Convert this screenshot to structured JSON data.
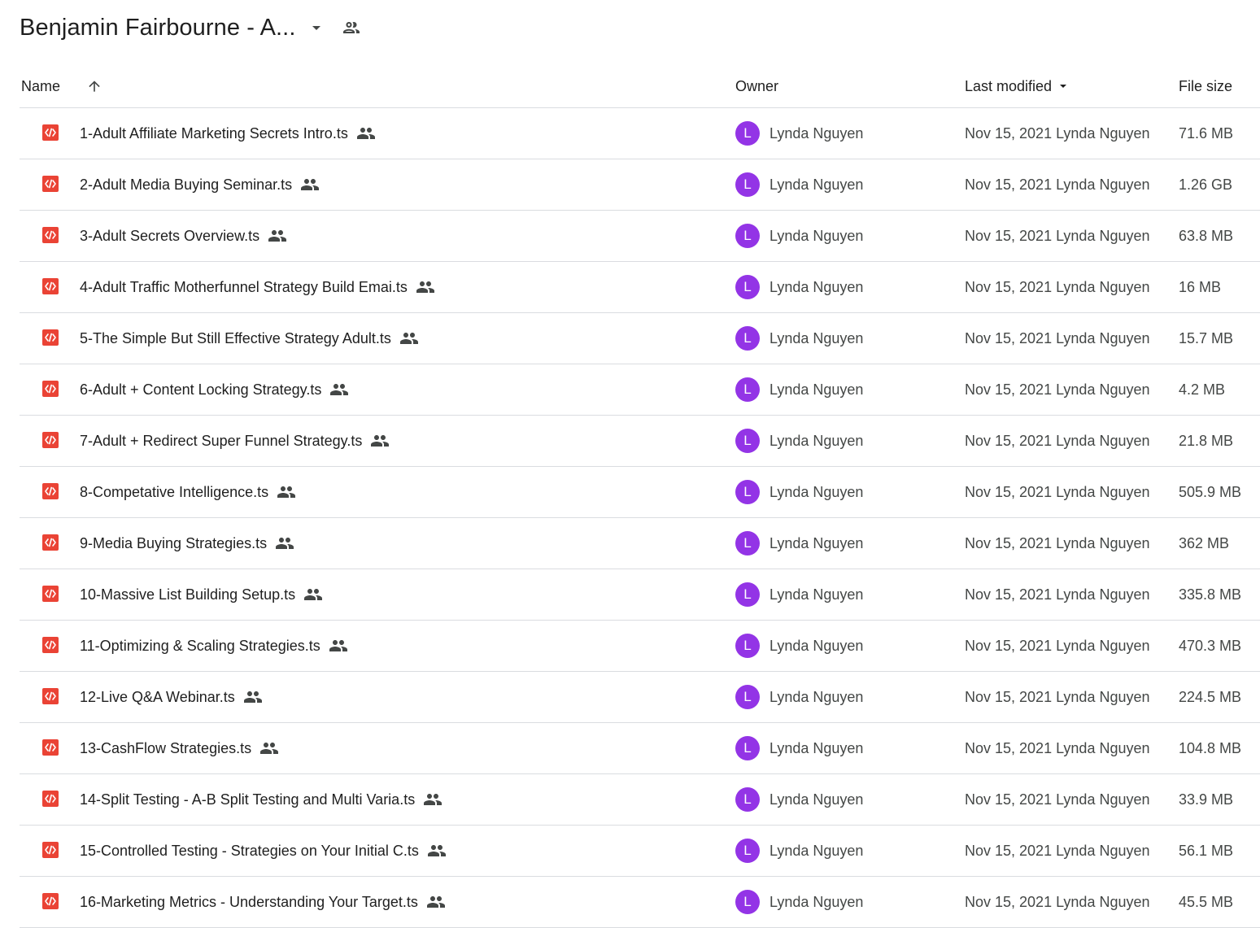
{
  "header": {
    "folder_title": "Benjamin Fairbourne - A...",
    "dropdown_icon": "arrow-drop-down-icon",
    "share_icon": "people-outline-icon"
  },
  "columns": {
    "name": "Name",
    "owner": "Owner",
    "last_modified": "Last modified",
    "file_size": "File size"
  },
  "sort": {
    "column": "Last modified",
    "icon": "arrow-up-icon"
  },
  "colors": {
    "file_icon": "#ea4335",
    "avatar": "#9334e6",
    "divider": "#dadce0"
  },
  "files": [
    {
      "name": "1-Adult Affiliate Marketing Secrets Intro.ts",
      "owner": "Lynda Nguyen",
      "owner_initial": "L",
      "modified": "Nov 15, 2021 Lynda Nguyen",
      "size": "71.6 MB"
    },
    {
      "name": "2-Adult Media Buying Seminar.ts",
      "owner": "Lynda Nguyen",
      "owner_initial": "L",
      "modified": "Nov 15, 2021 Lynda Nguyen",
      "size": "1.26 GB"
    },
    {
      "name": "3-Adult Secrets Overview.ts",
      "owner": "Lynda Nguyen",
      "owner_initial": "L",
      "modified": "Nov 15, 2021 Lynda Nguyen",
      "size": "63.8 MB"
    },
    {
      "name": "4-Adult Traffic Motherfunnel Strategy Build Emai.ts",
      "owner": "Lynda Nguyen",
      "owner_initial": "L",
      "modified": "Nov 15, 2021 Lynda Nguyen",
      "size": "16 MB"
    },
    {
      "name": "5-The Simple But Still Effective Strategy Adult.ts",
      "owner": "Lynda Nguyen",
      "owner_initial": "L",
      "modified": "Nov 15, 2021 Lynda Nguyen",
      "size": "15.7 MB"
    },
    {
      "name": "6-Adult + Content Locking Strategy.ts",
      "owner": "Lynda Nguyen",
      "owner_initial": "L",
      "modified": "Nov 15, 2021 Lynda Nguyen",
      "size": "4.2 MB"
    },
    {
      "name": "7-Adult + Redirect Super Funnel Strategy.ts",
      "owner": "Lynda Nguyen",
      "owner_initial": "L",
      "modified": "Nov 15, 2021 Lynda Nguyen",
      "size": "21.8 MB"
    },
    {
      "name": "8-Competative Intelligence.ts",
      "owner": "Lynda Nguyen",
      "owner_initial": "L",
      "modified": "Nov 15, 2021 Lynda Nguyen",
      "size": "505.9 MB"
    },
    {
      "name": "9-Media Buying Strategies.ts",
      "owner": "Lynda Nguyen",
      "owner_initial": "L",
      "modified": "Nov 15, 2021 Lynda Nguyen",
      "size": "362 MB"
    },
    {
      "name": "10-Massive List Building Setup.ts",
      "owner": "Lynda Nguyen",
      "owner_initial": "L",
      "modified": "Nov 15, 2021 Lynda Nguyen",
      "size": "335.8 MB"
    },
    {
      "name": "11-Optimizing & Scaling Strategies.ts",
      "owner": "Lynda Nguyen",
      "owner_initial": "L",
      "modified": "Nov 15, 2021 Lynda Nguyen",
      "size": "470.3 MB"
    },
    {
      "name": "12-Live Q&A Webinar.ts",
      "owner": "Lynda Nguyen",
      "owner_initial": "L",
      "modified": "Nov 15, 2021 Lynda Nguyen",
      "size": "224.5 MB"
    },
    {
      "name": "13-CashFlow Strategies.ts",
      "owner": "Lynda Nguyen",
      "owner_initial": "L",
      "modified": "Nov 15, 2021 Lynda Nguyen",
      "size": "104.8 MB"
    },
    {
      "name": "14-Split Testing - A-B Split Testing and Multi Varia.ts",
      "owner": "Lynda Nguyen",
      "owner_initial": "L",
      "modified": "Nov 15, 2021 Lynda Nguyen",
      "size": "33.9 MB"
    },
    {
      "name": "15-Controlled Testing - Strategies on Your Initial C.ts",
      "owner": "Lynda Nguyen",
      "owner_initial": "L",
      "modified": "Nov 15, 2021 Lynda Nguyen",
      "size": "56.1 MB"
    },
    {
      "name": "16-Marketing Metrics - Understanding Your Target.ts",
      "owner": "Lynda Nguyen",
      "owner_initial": "L",
      "modified": "Nov 15, 2021 Lynda Nguyen",
      "size": "45.5 MB"
    }
  ]
}
